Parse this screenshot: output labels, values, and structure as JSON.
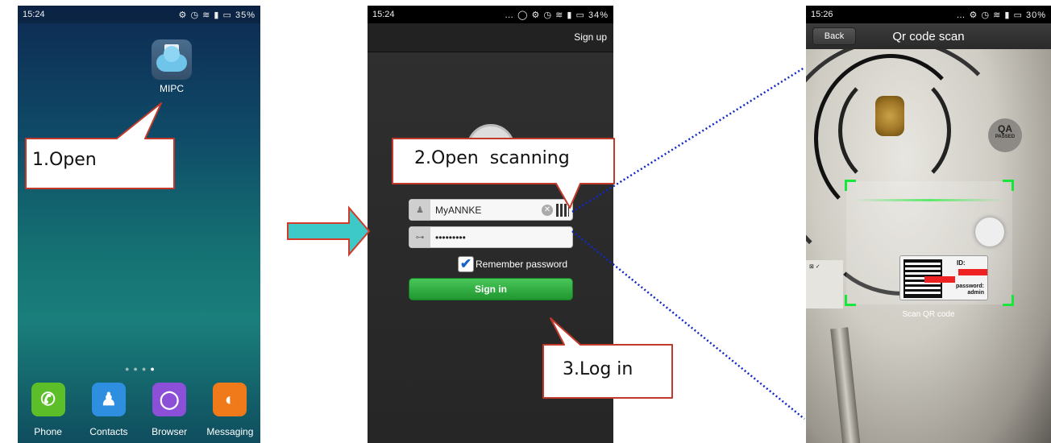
{
  "phone1": {
    "time": "15:24",
    "status_icons": "⚙ ◷ ≋ ▮ ▭",
    "battery": "35%",
    "app_label": "MIPC",
    "dock": [
      {
        "label": "Phone",
        "glyph": "✆",
        "color": "#5cbf2a"
      },
      {
        "label": "Contacts",
        "glyph": "♟",
        "color": "#2e8fe0"
      },
      {
        "label": "Browser",
        "glyph": "◯",
        "color": "#8b4fd8"
      },
      {
        "label": "Messaging",
        "glyph": "◐",
        "color": "#f07a1a"
      }
    ]
  },
  "phone2": {
    "time": "15:24",
    "status_icons": "… ◯ ⚙ ◷ ≋ ▮ ▭",
    "battery": "34%",
    "signup_label": "Sign up",
    "username_value": "MyANNKE",
    "password_value": "•••••••••",
    "remember_label": "Remember password",
    "signin_label": "Sign in"
  },
  "phone3": {
    "time": "15:26",
    "status_icons": "… ⚙ ◷ ≋ ▮ ▭",
    "battery": "30%",
    "back_label": "Back",
    "title": "Qr code scan",
    "scan_hint": "Scan QR code",
    "sticker": "QA",
    "sticker_small": "PASSED",
    "label_id": "ID:",
    "label_password": "password: admin"
  },
  "callouts": {
    "open": "1.Open",
    "open_scanning": "2.Open  scanning",
    "log_in": "3.Log in"
  },
  "colors": {
    "arrow_fill": "#3ec9c9",
    "arrow_stroke": "#d43a2a",
    "callout_stroke": "#c0392b",
    "dotted_line": "#1028c8"
  }
}
